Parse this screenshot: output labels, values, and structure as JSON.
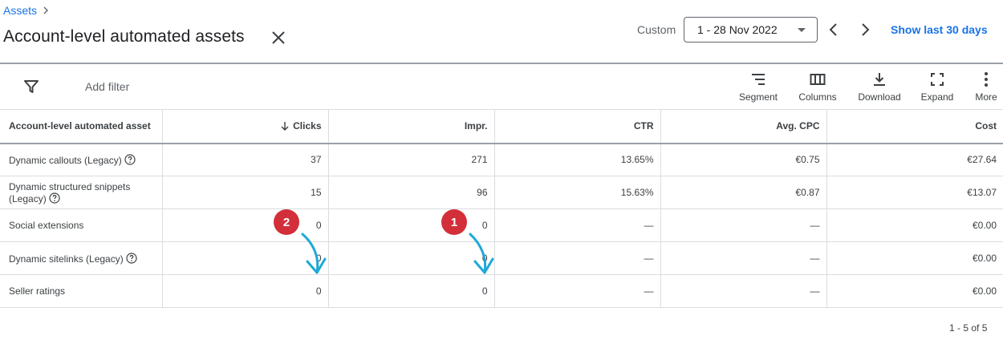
{
  "breadcrumb": {
    "label": "Assets"
  },
  "header": {
    "title": "Account-level automated assets"
  },
  "date_range": {
    "label": "Custom",
    "value": "1 - 28 Nov 2022",
    "show_last": "Show last 30 days"
  },
  "toolbar": {
    "add_filter": "Add filter",
    "segment": "Segment",
    "columns": "Columns",
    "download": "Download",
    "expand": "Expand",
    "more": "More"
  },
  "table": {
    "headers": [
      "Account-level automated asset",
      "Clicks",
      "Impr.",
      "CTR",
      "Avg. CPC",
      "Cost"
    ],
    "rows": [
      {
        "name": "Dynamic callouts (Legacy)",
        "help": true,
        "clicks": "37",
        "impr": "271",
        "ctr": "13.65%",
        "cpc": "€0.75",
        "cost": "€27.64"
      },
      {
        "name": "Dynamic structured snippets (Legacy)",
        "help": true,
        "clicks": "15",
        "impr": "96",
        "ctr": "15.63%",
        "cpc": "€0.87",
        "cost": "€13.07"
      },
      {
        "name": "Social extensions",
        "help": false,
        "clicks": "0",
        "impr": "0",
        "ctr": "—",
        "cpc": "—",
        "cost": "€0.00"
      },
      {
        "name": "Dynamic sitelinks (Legacy)",
        "help": true,
        "clicks": "0",
        "impr": "0",
        "ctr": "—",
        "cpc": "—",
        "cost": "€0.00"
      },
      {
        "name": "Seller ratings",
        "help": false,
        "clicks": "0",
        "impr": "0",
        "ctr": "—",
        "cpc": "—",
        "cost": "€0.00"
      }
    ]
  },
  "pager": {
    "text": "1 - 5 of 5"
  },
  "annotations": {
    "badge_1": "1",
    "badge_2": "2",
    "color": "#d32f3a",
    "arrow_color": "#1ea9d8"
  }
}
